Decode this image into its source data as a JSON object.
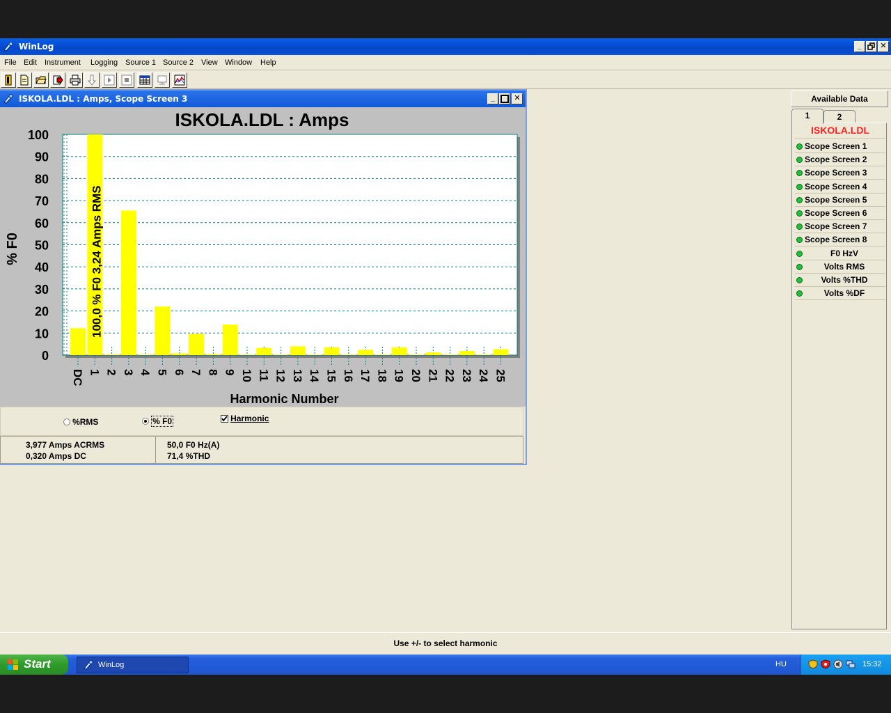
{
  "app": {
    "title": "WinLog",
    "menu": [
      "File",
      "Edit",
      "Instrument",
      "Logging",
      "Source 1",
      "Source 2",
      "View",
      "Window",
      "Help"
    ]
  },
  "child": {
    "title": "ISKOLA.LDL : Amps, Scope Screen 3"
  },
  "chart_data": {
    "type": "bar",
    "title": "ISKOLA.LDL : Amps",
    "xlabel": "Harmonic Number",
    "ylabel": "% F0",
    "ylim": [
      0,
      100
    ],
    "yticks": [
      0,
      10,
      20,
      30,
      40,
      50,
      60,
      70,
      80,
      90,
      100
    ],
    "categories": [
      "DC",
      "1",
      "2",
      "3",
      "4",
      "5",
      "6",
      "7",
      "8",
      "9",
      "10",
      "11",
      "12",
      "13",
      "14",
      "15",
      "16",
      "17",
      "18",
      "19",
      "20",
      "21",
      "22",
      "23",
      "24",
      "25"
    ],
    "values": [
      12.2,
      100,
      0.3,
      65.5,
      0.2,
      22,
      0.8,
      9.6,
      0.4,
      13.8,
      0.2,
      3.3,
      0.2,
      4,
      0.2,
      3.5,
      0.2,
      2.4,
      0.2,
      3.5,
      0.2,
      1.2,
      0.2,
      1.9,
      0.2,
      2.7
    ],
    "highlight_label": "100,0 % F0  3,24 Amps RMS",
    "highlight_index": 1,
    "grid": true,
    "bar_color": "#ffff00"
  },
  "options": {
    "rms_label": "%RMS",
    "f0_label": "% F0",
    "harmonic_label": "Harmonic",
    "selected": "% F0",
    "harmonic_checked": true
  },
  "info": {
    "acrms": "3,977 Amps ACRMS",
    "dc": "0,320 Amps DC",
    "freq": "50,0 F0 Hz(A)",
    "thd": "71,4 %THD"
  },
  "panel": {
    "header": "Available Data",
    "tabs": [
      "1",
      "2"
    ],
    "file": "ISKOLA.LDL",
    "items": [
      "Scope Screen 1",
      "Scope Screen 2",
      "Scope Screen 3",
      "Scope Screen 4",
      "Scope Screen 5",
      "Scope Screen 6",
      "Scope Screen 7",
      "Scope Screen 8",
      "F0 HzV",
      "Volts RMS",
      "Volts %THD",
      "Volts %DF"
    ]
  },
  "status": {
    "message": "Use +/- to select harmonic"
  },
  "taskbar": {
    "start": "Start",
    "task": "WinLog",
    "lang": "HU",
    "clock": "15:32"
  },
  "colors": {
    "accent_red": "#ff2020",
    "status_green": "#1fc23a"
  }
}
